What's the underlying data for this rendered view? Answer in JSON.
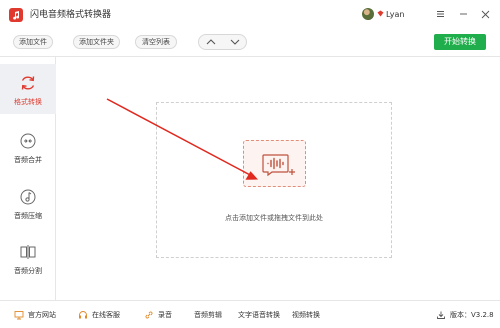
{
  "window": {
    "title": "闪电音频格式转换器",
    "username": "Lyan"
  },
  "toolbar": {
    "add_file": "添加文件",
    "add_folder": "添加文件夹",
    "clear_list": "清空列表",
    "start_convert": "开始转换"
  },
  "sidebar": {
    "items": [
      {
        "label": "格式转换",
        "icon": "refresh-icon",
        "active": true
      },
      {
        "label": "音频合并",
        "icon": "merge-icon",
        "active": false
      },
      {
        "label": "音频压缩",
        "icon": "compress-icon",
        "active": false
      },
      {
        "label": "音频分割",
        "icon": "split-icon",
        "active": false
      }
    ]
  },
  "main": {
    "drop_hint": "点击添加文件或拖拽文件到此处"
  },
  "footer": {
    "official_site": "官方网站",
    "online_service": "在线客服",
    "recording": "录音",
    "audio_editing": "音频剪辑",
    "text_to_speech": "文字语音转换",
    "video_convert": "视频转换",
    "version": "版本：V3.2.8"
  },
  "colors": {
    "accent": "#e03a2f",
    "start_button": "#1fae4b",
    "active_sidebar_bg": "#eef0f3"
  }
}
